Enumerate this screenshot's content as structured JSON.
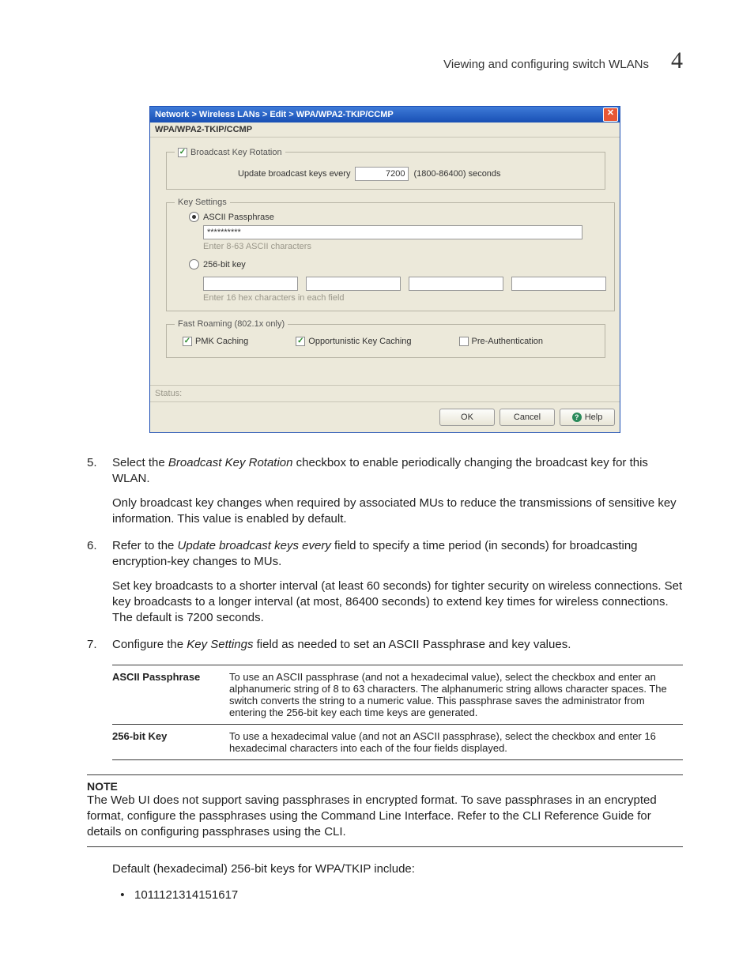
{
  "header": {
    "title": "Viewing and configuring switch WLANs",
    "chapter": "4"
  },
  "dialog": {
    "titlebar": "Network > Wireless LANs > Edit > WPA/WPA2-TKIP/CCMP",
    "subhead": "WPA/WPA2-TKIP/CCMP",
    "broadcast": {
      "checkbox_label": "Broadcast Key Rotation",
      "checked": "✓",
      "update_label": "Update broadcast keys every",
      "value": "7200",
      "range": "(1800-86400) seconds"
    },
    "key_settings": {
      "legend": "Key Settings",
      "ascii_label": "ASCII Passphrase",
      "ascii_value": "**********",
      "ascii_hint": "Enter 8-63 ASCII characters",
      "key256_label": "256-bit key",
      "key256_hint": "Enter 16 hex characters in each field"
    },
    "fast_roaming": {
      "legend": "Fast Roaming (802.1x only)",
      "pmk_label": "PMK Caching",
      "pmk_checked": "✓",
      "opp_label": "Opportunistic Key Caching",
      "opp_checked": "✓",
      "preauth_label": "Pre-Authentication",
      "preauth_checked": ""
    },
    "status_label": "Status:",
    "buttons": {
      "ok": "OK",
      "cancel": "Cancel",
      "help": "Help"
    }
  },
  "steps": {
    "s5_num": "5.",
    "s5_a": "Select the ",
    "s5_i": "Broadcast Key Rotation",
    "s5_b": " checkbox to enable periodically changing the broadcast key for this WLAN.",
    "s5_para": "Only broadcast key changes when required by associated MUs to reduce the transmissions of sensitive key information. This value is enabled by default.",
    "s6_num": "6.",
    "s6_a": "Refer to the ",
    "s6_i": "Update broadcast keys every",
    "s6_b": " field to specify a time period (in seconds) for broadcasting encryption-key changes to MUs.",
    "s6_para": "Set key broadcasts to a shorter interval (at least 60 seconds) for tighter security on wireless connections. Set key broadcasts to a longer interval (at most, 86400 seconds) to extend key times for wireless connections. The default is 7200 seconds.",
    "s7_num": "7.",
    "s7_a": "Configure the ",
    "s7_i": "Key Settings",
    "s7_b": " field as needed to set an ASCII Passphrase and key values."
  },
  "table": {
    "r1_term": "ASCII Passphrase",
    "r1_desc": "To use an ASCII passphrase (and not a hexadecimal value), select the checkbox and enter an alphanumeric string of 8 to 63 characters. The alphanumeric string allows character spaces. The switch converts the string to a numeric value. This passphrase saves the administrator from entering the 256-bit key each time keys are generated.",
    "r2_term": "256-bit Key",
    "r2_desc": "To use a hexadecimal value (and not an ASCII passphrase), select the checkbox and enter 16 hexadecimal characters into each of the four fields displayed."
  },
  "note": {
    "head": "NOTE",
    "body": "The Web UI does not support saving passphrases in encrypted format. To save passphrases in an encrypted format, configure the passphrases using the Command Line Interface. Refer to the CLI Reference Guide for details on configuring passphrases using the CLI."
  },
  "after_note": {
    "intro": "Default (hexadecimal) 256-bit keys for WPA/TKIP include:",
    "bullet1": "1011121314151617"
  }
}
